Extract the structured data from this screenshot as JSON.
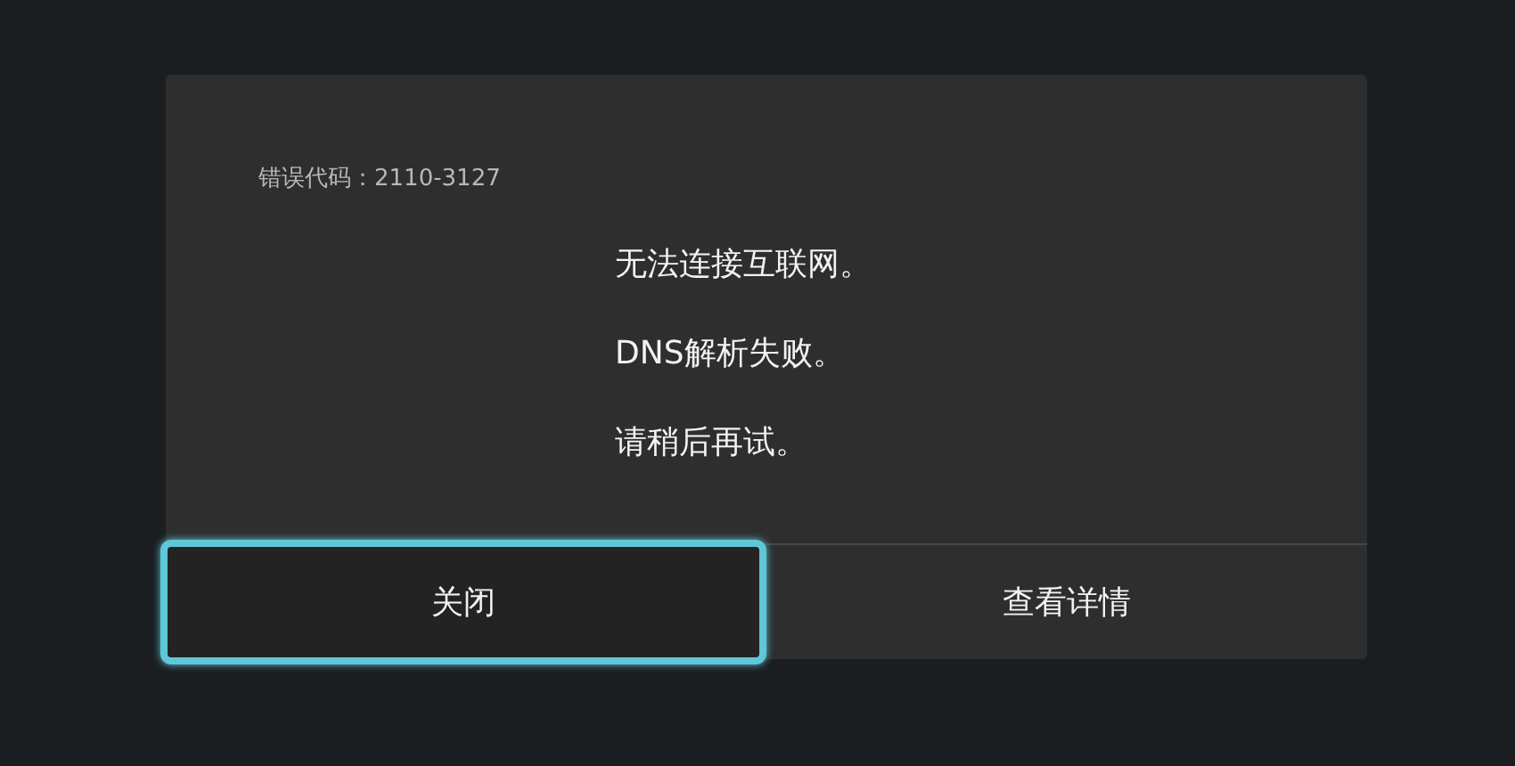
{
  "dialog": {
    "error_code": "错误代码：2110-3127",
    "messages": [
      "无法连接互联网。",
      "DNS解析失败。",
      "请稍后再试。"
    ],
    "buttons": [
      {
        "label": "关闭",
        "selected": true
      },
      {
        "label": "查看详情",
        "selected": false
      }
    ]
  }
}
